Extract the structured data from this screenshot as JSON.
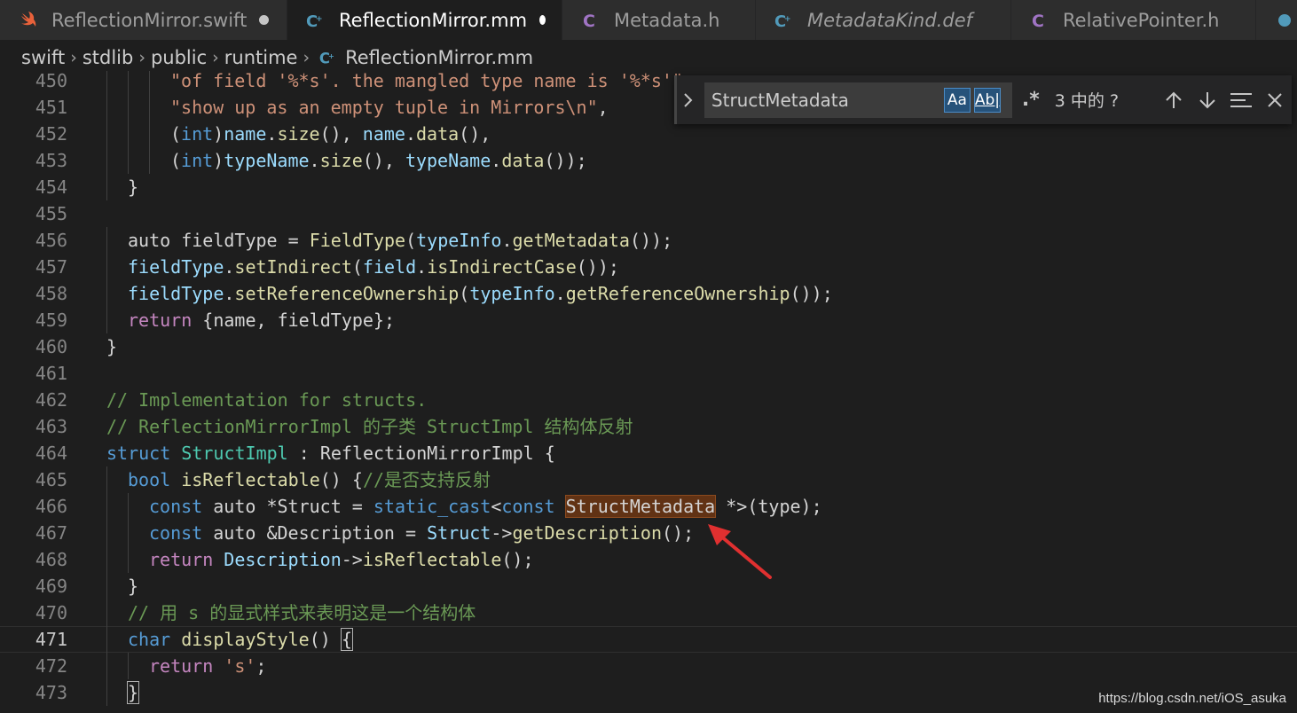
{
  "tabs": [
    {
      "label": "ReflectionMirror.swift",
      "icon": "swift-icon",
      "modified": true,
      "active": false
    },
    {
      "label": "ReflectionMirror.mm",
      "icon": "cpp-icon",
      "modified": true,
      "active": true
    },
    {
      "label": "Metadata.h",
      "icon": "c-header-icon",
      "modified": false,
      "active": false
    },
    {
      "label": "MetadataKind.def",
      "icon": "cpp-icon",
      "modified": false,
      "active": false
    },
    {
      "label": "RelativePointer.h",
      "icon": "c-header-icon",
      "modified": false,
      "active": false
    }
  ],
  "breadcrumb": [
    "swift",
    "stdlib",
    "public",
    "runtime",
    "ReflectionMirror.mm"
  ],
  "find": {
    "query": "StructMetadata",
    "match_case_label": "Aa",
    "whole_word_label": "Ab|",
    "regex_label": ".*",
    "match_count": "3 中的 ?"
  },
  "lines": [
    {
      "n": "450",
      "indent": 3,
      "tokens": [
        [
          "str",
          "\"of field '%*s'. the mangled type name is '%*s'\""
        ]
      ]
    },
    {
      "n": "451",
      "indent": 3,
      "tokens": [
        [
          "str",
          "\"show up as an empty tuple in Mirrors\\n\""
        ],
        [
          "pl",
          ","
        ]
      ]
    },
    {
      "n": "452",
      "indent": 3,
      "tokens": [
        [
          "pl",
          "("
        ],
        [
          "kw",
          "int"
        ],
        [
          "pl",
          ")"
        ],
        [
          "var",
          "name"
        ],
        [
          "pl",
          "."
        ],
        [
          "fn",
          "size"
        ],
        [
          "pl",
          "(), "
        ],
        [
          "var",
          "name"
        ],
        [
          "pl",
          "."
        ],
        [
          "fn",
          "data"
        ],
        [
          "pl",
          "(),"
        ]
      ]
    },
    {
      "n": "453",
      "indent": 3,
      "tokens": [
        [
          "pl",
          "("
        ],
        [
          "kw",
          "int"
        ],
        [
          "pl",
          ")"
        ],
        [
          "var",
          "typeName"
        ],
        [
          "pl",
          "."
        ],
        [
          "fn",
          "size"
        ],
        [
          "pl",
          "(), "
        ],
        [
          "var",
          "typeName"
        ],
        [
          "pl",
          "."
        ],
        [
          "fn",
          "data"
        ],
        [
          "pl",
          "());"
        ]
      ]
    },
    {
      "n": "454",
      "indent": 1,
      "tokens": [
        [
          "pl",
          "}"
        ]
      ]
    },
    {
      "n": "455",
      "indent": 0,
      "tokens": []
    },
    {
      "n": "456",
      "indent": 1,
      "tokens": [
        [
          "pl",
          "auto fieldType = "
        ],
        [
          "fn",
          "FieldType"
        ],
        [
          "pl",
          "("
        ],
        [
          "var",
          "typeInfo"
        ],
        [
          "pl",
          "."
        ],
        [
          "fn",
          "getMetadata"
        ],
        [
          "pl",
          "());"
        ]
      ]
    },
    {
      "n": "457",
      "indent": 1,
      "tokens": [
        [
          "var",
          "fieldType"
        ],
        [
          "pl",
          "."
        ],
        [
          "fn",
          "setIndirect"
        ],
        [
          "pl",
          "("
        ],
        [
          "var",
          "field"
        ],
        [
          "pl",
          "."
        ],
        [
          "fn",
          "isIndirectCase"
        ],
        [
          "pl",
          "());"
        ]
      ]
    },
    {
      "n": "458",
      "indent": 1,
      "tokens": [
        [
          "var",
          "fieldType"
        ],
        [
          "pl",
          "."
        ],
        [
          "fn",
          "setReferenceOwnership"
        ],
        [
          "pl",
          "("
        ],
        [
          "var",
          "typeInfo"
        ],
        [
          "pl",
          "."
        ],
        [
          "fn",
          "getReferenceOwnership"
        ],
        [
          "pl",
          "());"
        ]
      ]
    },
    {
      "n": "459",
      "indent": 1,
      "tokens": [
        [
          "ctl",
          "return"
        ],
        [
          "pl",
          " {name, fieldType};"
        ]
      ]
    },
    {
      "n": "460",
      "indent": 0,
      "tokens": [
        [
          "pl",
          "}"
        ]
      ]
    },
    {
      "n": "461",
      "indent": 0,
      "tokens": []
    },
    {
      "n": "462",
      "indent": 0,
      "tokens": [
        [
          "cm",
          "// Implementation for structs."
        ]
      ]
    },
    {
      "n": "463",
      "indent": 0,
      "tokens": [
        [
          "cm",
          "// ReflectionMirrorImpl 的子类 StructImpl 结构体反射"
        ]
      ]
    },
    {
      "n": "464",
      "indent": 0,
      "tokens": [
        [
          "kw",
          "struct"
        ],
        [
          "pl",
          " "
        ],
        [
          "ty",
          "StructImpl"
        ],
        [
          "pl",
          " : ReflectionMirrorImpl {"
        ]
      ]
    },
    {
      "n": "465",
      "indent": 1,
      "tokens": [
        [
          "kw",
          "bool"
        ],
        [
          "pl",
          " "
        ],
        [
          "fn",
          "isReflectable"
        ],
        [
          "pl",
          "() {"
        ],
        [
          "cm",
          "//是否支持反射"
        ]
      ]
    },
    {
      "n": "466",
      "indent": 2,
      "tokens": [
        [
          "kw",
          "const"
        ],
        [
          "pl",
          " auto *Struct = "
        ],
        [
          "kw",
          "static_cast"
        ],
        [
          "pl",
          "<"
        ],
        [
          "kw",
          "const"
        ],
        [
          "pl",
          " "
        ],
        [
          "hl",
          "StructMetadata"
        ],
        [
          "pl",
          " *>(type);"
        ]
      ]
    },
    {
      "n": "467",
      "indent": 2,
      "tokens": [
        [
          "kw",
          "const"
        ],
        [
          "pl",
          " auto &Description = "
        ],
        [
          "var",
          "Struct"
        ],
        [
          "pl",
          "->"
        ],
        [
          "fn",
          "getDescription"
        ],
        [
          "pl",
          "();"
        ]
      ]
    },
    {
      "n": "468",
      "indent": 2,
      "tokens": [
        [
          "ctl",
          "return"
        ],
        [
          "pl",
          " "
        ],
        [
          "var",
          "Description"
        ],
        [
          "pl",
          "->"
        ],
        [
          "fn",
          "isReflectable"
        ],
        [
          "pl",
          "();"
        ]
      ]
    },
    {
      "n": "469",
      "indent": 1,
      "tokens": [
        [
          "pl",
          "}"
        ]
      ]
    },
    {
      "n": "470",
      "indent": 1,
      "tokens": [
        [
          "cm",
          "// 用 s 的显式样式来表明这是一个结构体"
        ]
      ]
    },
    {
      "n": "471",
      "indent": 1,
      "current": true,
      "tokens": [
        [
          "kw",
          "char"
        ],
        [
          "pl",
          " "
        ],
        [
          "fn",
          "displayStyle"
        ],
        [
          "pl",
          "() "
        ],
        [
          "brk",
          "{"
        ]
      ]
    },
    {
      "n": "472",
      "indent": 2,
      "tokens": [
        [
          "ctl",
          "return"
        ],
        [
          "pl",
          " "
        ],
        [
          "str",
          "'s'"
        ],
        [
          "pl",
          ";"
        ]
      ]
    },
    {
      "n": "473",
      "indent": 1,
      "tokens": [
        [
          "brk",
          "}"
        ]
      ]
    }
  ],
  "watermark": "https://blog.csdn.net/iOS_asuka"
}
